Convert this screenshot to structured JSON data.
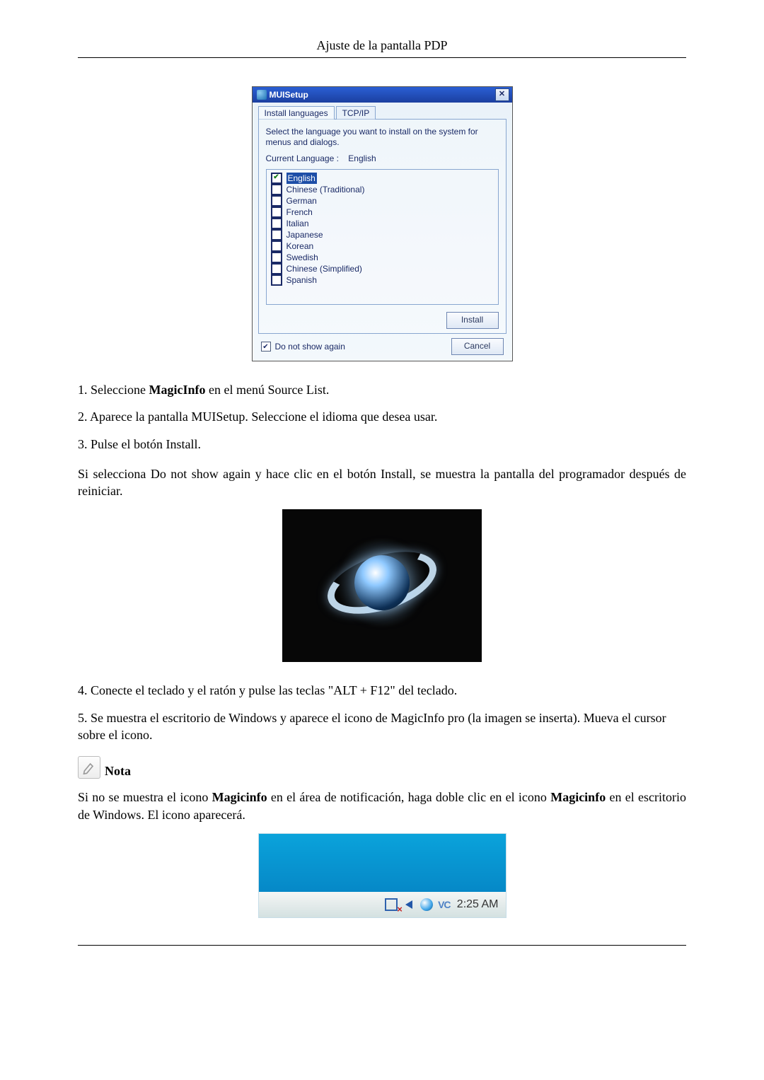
{
  "page_header": "Ajuste de la pantalla PDP",
  "mui": {
    "title": "MUISetup",
    "close_glyph": "✕",
    "tab_install": "Install languages",
    "tab_tcpip": "TCP/IP",
    "instruction": "Select the language you want to install on the system for menus and dialogs.",
    "current_language_label": "Current Language   :",
    "current_language_value": "English",
    "items": [
      {
        "label": "English",
        "checked": true,
        "selected": true
      },
      {
        "label": "Chinese (Traditional)",
        "checked": false
      },
      {
        "label": "German",
        "checked": false
      },
      {
        "label": "French",
        "checked": false
      },
      {
        "label": "Italian",
        "checked": false
      },
      {
        "label": "Japanese",
        "checked": false
      },
      {
        "label": "Korean",
        "checked": false
      },
      {
        "label": "Swedish",
        "checked": false
      },
      {
        "label": "Chinese (Simplified)",
        "checked": false
      },
      {
        "label": "Spanish",
        "checked": false
      }
    ],
    "install_btn": "Install",
    "do_not_show": "Do not show again",
    "do_not_show_checked": true,
    "cancel_btn": "Cancel"
  },
  "steps": {
    "s1_pre": "1. Seleccione ",
    "s1_bold": "MagicInfo",
    "s1_post": " en el menú Source List.",
    "s2": "2. Aparece la pantalla MUISetup. Seleccione el idioma que desea usar.",
    "s3": "3. Pulse el botón Install.",
    "s4": "4. Conecte el teclado y el ratón y pulse las teclas \"ALT + F12\" del teclado.",
    "s5": "5. Se muestra el escritorio de Windows y aparece el icono de MagicInfo pro (la imagen se inserta). Mueva el cursor sobre el icono."
  },
  "para_after3": "Si selecciona Do not show again y hace clic en el botón Install, se muestra la pantalla del programador después de reiniciar.",
  "note_label": "Nota",
  "note_para_pre": "Si no se muestra el icono ",
  "note_para_b1": "Magicinfo ",
  "note_para_mid": " en el área de notificación, haga doble clic en el icono ",
  "note_para_b2": "Magicinfo",
  "note_para_post": " en el escritorio de Windows. El icono aparecerá.",
  "taskbar": {
    "vc": "VC",
    "time": "2:25 AM"
  }
}
